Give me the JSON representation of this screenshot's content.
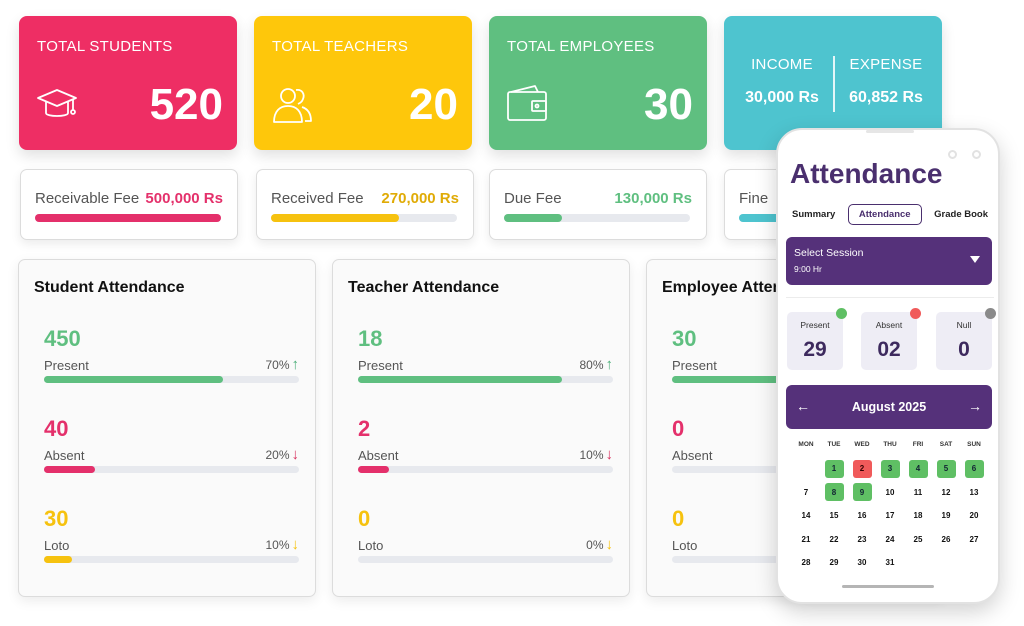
{
  "stats": {
    "students": {
      "title": "TOTAL STUDENTS",
      "value": "520",
      "icon": "graduation-cap-icon"
    },
    "teachers": {
      "title": "TOTAL TEACHERS",
      "value": "20",
      "icon": "users-icon"
    },
    "employees": {
      "title": "TOTAL EMPLOYEES",
      "value": "30",
      "icon": "wallet-icon"
    },
    "finance": {
      "income_label": "INCOME",
      "income_value": "30,000 Rs",
      "expense_label": "EXPENSE",
      "expense_value": "60,852 Rs"
    }
  },
  "fees": [
    {
      "label": "Receivable Fee",
      "amount": "500,000 Rs",
      "color": "#e4306b",
      "progress": 1.0
    },
    {
      "label": "Received Fee",
      "amount": "270,000 Rs",
      "color": "#f6c20f",
      "progress": 0.69
    },
    {
      "label": "Due Fee",
      "amount": "130,000 Rs",
      "color": "#5fbf80",
      "progress": 0.31
    },
    {
      "label": "Fine",
      "amount": "",
      "color": "#4ec4cf",
      "progress": 1.0
    }
  ],
  "attendance": [
    {
      "title": "Student Attendance",
      "rows": [
        {
          "value": "450",
          "label": "Present",
          "pct": "70%",
          "dir": "up",
          "progress": 0.7
        },
        {
          "value": "40",
          "label": "Absent",
          "pct": "20%",
          "dir": "down",
          "progress": 0.2
        },
        {
          "value": "30",
          "label": "Loto",
          "pct": "10%",
          "dir": "down",
          "progress": 0.11
        }
      ]
    },
    {
      "title": "Teacher Attendance",
      "rows": [
        {
          "value": "18",
          "label": "Present",
          "pct": "80%",
          "dir": "up",
          "progress": 0.8
        },
        {
          "value": "2",
          "label": "Absent",
          "pct": "10%",
          "dir": "down",
          "progress": 0.12
        },
        {
          "value": "0",
          "label": "Loto",
          "pct": "0%",
          "dir": "down",
          "progress": 0.0
        }
      ]
    },
    {
      "title": "Employee Attendance",
      "rows": [
        {
          "value": "30",
          "label": "Present",
          "pct": "",
          "dir": "up",
          "progress": 0.8
        },
        {
          "value": "0",
          "label": "Absent",
          "pct": "",
          "dir": "down",
          "progress": 0.0
        },
        {
          "value": "0",
          "label": "Loto",
          "pct": "",
          "dir": "down",
          "progress": 0.0
        }
      ]
    }
  ],
  "colors": {
    "present": "#5fbf80",
    "absent": "#e4306b",
    "loto": "#f6c20f",
    "brand": "#55317a",
    "up": "#4caf79",
    "down": "#d8325f",
    "loto_arrow": "#f6c20f"
  },
  "phone": {
    "title": "Attendance",
    "tabs": [
      "Summary",
      "Attendance",
      "Grade Book"
    ],
    "active_tab": "Attendance",
    "session_label": "Select Session",
    "session_value": "9:00 Hr",
    "summary": [
      {
        "label": "Present",
        "value": "29",
        "dot": "#5fbf64"
      },
      {
        "label": "Absent",
        "value": "02",
        "dot": "#f05a5a"
      },
      {
        "label": "Null",
        "value": "0",
        "dot": "#8a8a8a"
      }
    ],
    "month": "August 2025",
    "prev_icon": "arrow-left-icon",
    "next_icon": "arrow-right-icon",
    "weekdays": [
      "MON",
      "TUE",
      "WED",
      "THU",
      "FRI",
      "SAT",
      "SUN"
    ],
    "leading_blanks": 1,
    "days_in_month": 31,
    "present_days": [
      1,
      3,
      4,
      5,
      6,
      8,
      9
    ],
    "absent_days": [
      2
    ]
  }
}
